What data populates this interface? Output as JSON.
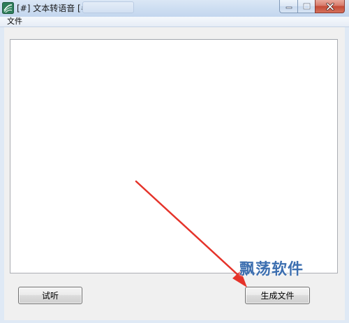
{
  "window": {
    "title": "[#] 文本转语音 [#]"
  },
  "menubar": {
    "items": [
      {
        "label": "文件"
      }
    ]
  },
  "editor": {
    "value": ""
  },
  "buttons": {
    "listen_label": "试听",
    "generate_label": "生成文件"
  },
  "watermark": {
    "text": "飘荡软件"
  },
  "colors": {
    "arrow": "#e5332a",
    "watermark": "#3d6fb0",
    "titlebar": "#cfdff2"
  },
  "icons": {
    "app": "app-logo-icon",
    "minimize": "minimize-icon",
    "maximize": "maximize-icon",
    "close": "close-icon"
  }
}
